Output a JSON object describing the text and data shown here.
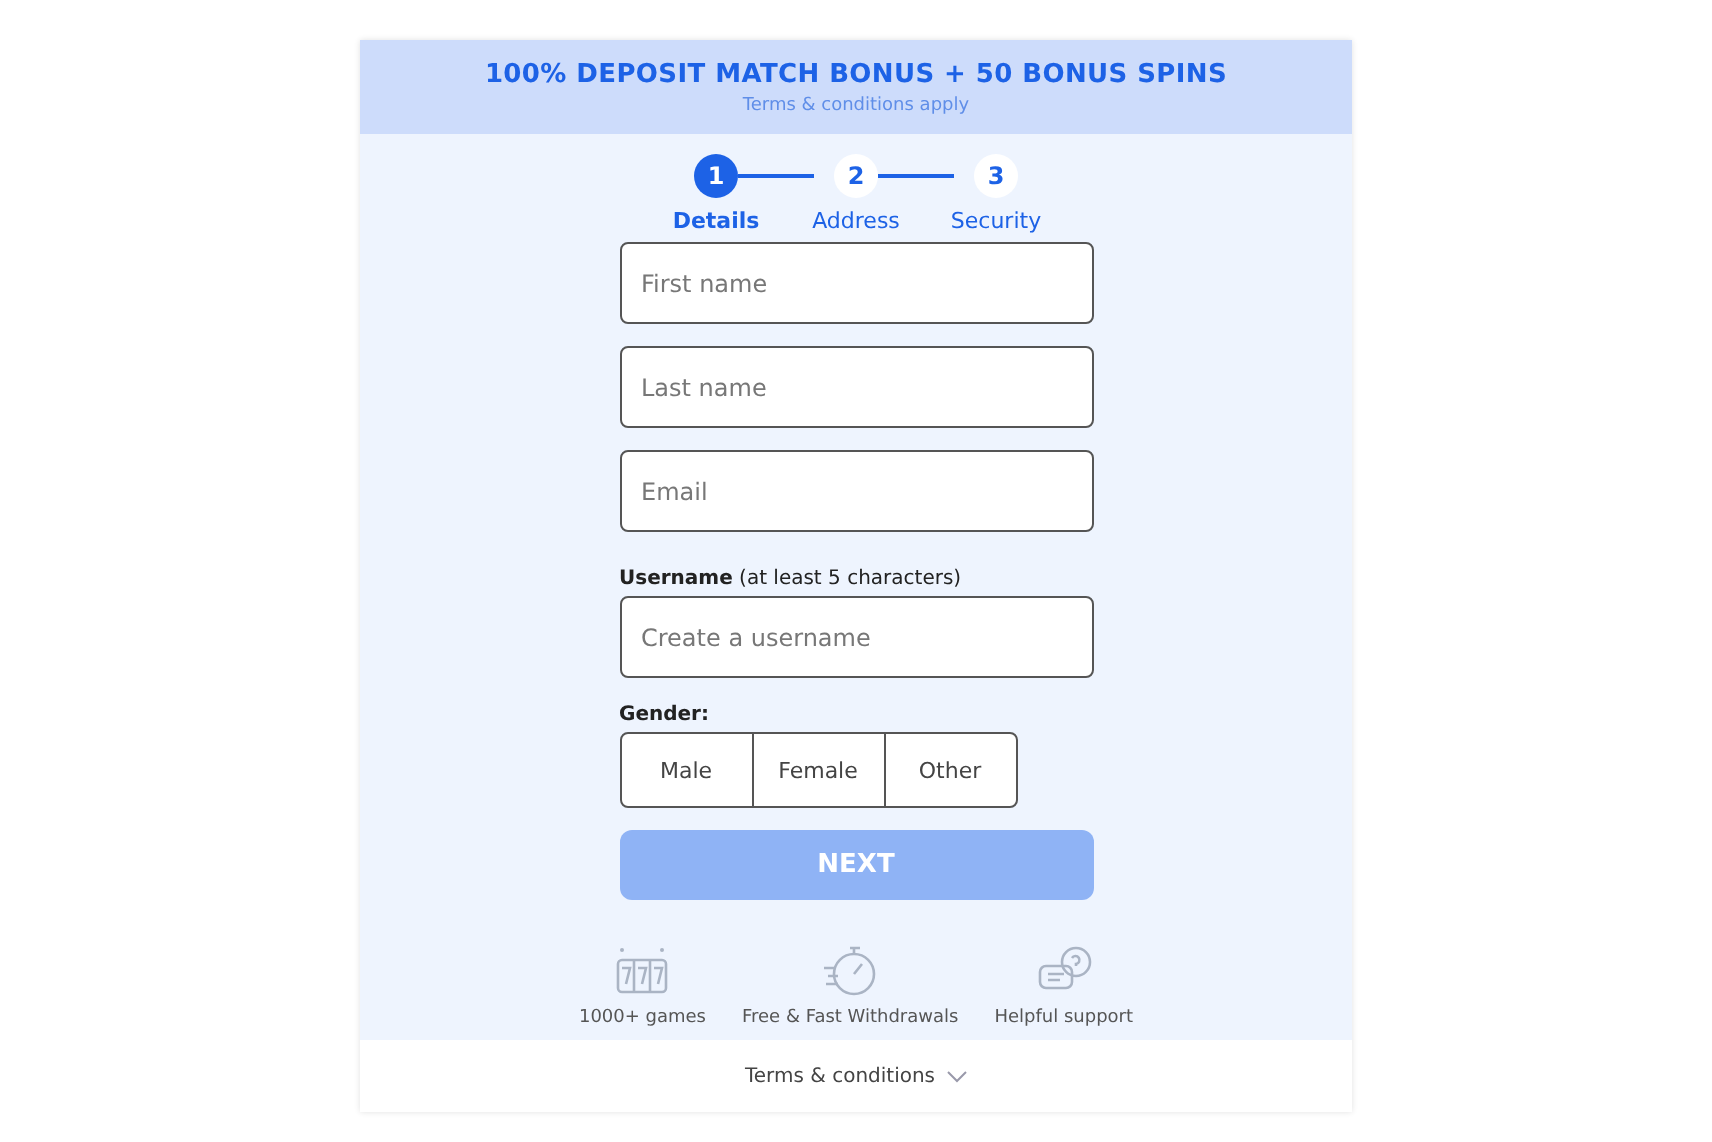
{
  "promo": {
    "title": "100% DEPOSIT MATCH BONUS + 50 BONUS SPINS",
    "subtitle": "Terms & conditions apply"
  },
  "steps": [
    {
      "number": "1",
      "label": "Details",
      "selected": true
    },
    {
      "number": "2",
      "label": "Address",
      "selected": false
    },
    {
      "number": "3",
      "label": "Security",
      "selected": false
    }
  ],
  "fields": [
    {
      "placeholder": "First name"
    },
    {
      "placeholder": "Last name"
    },
    {
      "placeholder": "Email"
    },
    {
      "label": "**Username** (at least 5 characters)",
      "placeholder": "Create a username"
    }
  ],
  "gender": {
    "label": "Gender:",
    "options": [
      {
        "label": "Male",
        "selected": false
      },
      {
        "label": "Female",
        "selected": false
      },
      {
        "label": "Other",
        "selected": false
      }
    ]
  },
  "next_button": {
    "label": "NEXT",
    "disabled": true
  },
  "features": [
    {
      "kind": "slots",
      "label": "1000+ games"
    },
    {
      "kind": "stopwatch",
      "label": "Free & Fast Withdrawals"
    },
    {
      "kind": "support",
      "label": "Helpful support"
    }
  ],
  "footer": {
    "label": "Terms & conditions"
  }
}
